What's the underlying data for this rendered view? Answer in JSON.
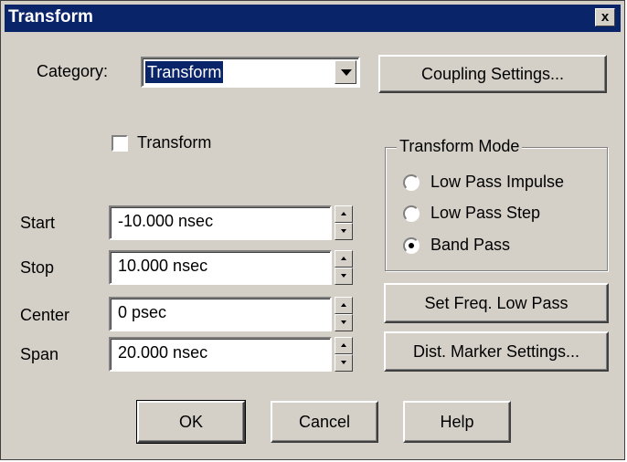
{
  "window": {
    "title": "Transform",
    "close_glyph": "x"
  },
  "category": {
    "label": "Category:",
    "value": "Transform"
  },
  "buttons": {
    "coupling": "Coupling Settings...",
    "set_freq": "Set Freq. Low Pass",
    "dist_marker": "Dist. Marker Settings...",
    "ok": "OK",
    "cancel": "Cancel",
    "help": "Help"
  },
  "transform_checkbox": {
    "label": "Transform",
    "checked": false
  },
  "transform_mode": {
    "title": "Transform Mode",
    "options": [
      {
        "label": "Low Pass Impulse",
        "selected": false
      },
      {
        "label": "Low Pass Step",
        "selected": false
      },
      {
        "label": "Band Pass",
        "selected": true
      }
    ]
  },
  "fields": [
    {
      "label": "Start",
      "value": "-10.000 nsec"
    },
    {
      "label": "Stop",
      "value": "10.000 nsec"
    },
    {
      "label": "Center",
      "value": "0 psec"
    },
    {
      "label": "Span",
      "value": "20.000 nsec"
    }
  ],
  "colors": {
    "title_bar": "#0a246a",
    "face": "#d4d0c8",
    "selection": "#0a246a"
  },
  "icons": {
    "close": "close-icon",
    "dropdown": "chevron-down-icon",
    "spin_up": "spin-up-icon",
    "spin_down": "spin-down-icon"
  }
}
